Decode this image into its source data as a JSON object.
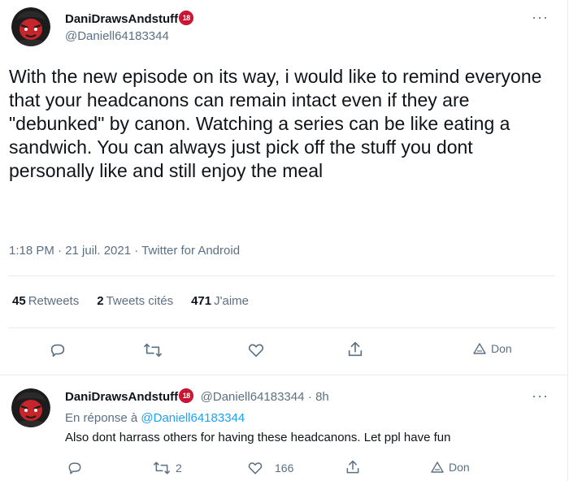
{
  "tweet": {
    "author": {
      "name": "DaniDrawsAndstuff",
      "badge": "18",
      "handle": "@Daniell64183344"
    },
    "more": "···",
    "text": "With the new episode on its way, i would like to remind everyone that your headcanons can remain intact even if they are \"debunked\" by canon. Watching a series can be like eating a sandwich. You can always just pick off the stuff you dont personally like and still enjoy the meal",
    "meta": "1:18 PM · 21 juil. 2021 · Twitter for Android",
    "stats": {
      "retweets_count": "45",
      "retweets_label": "Retweets",
      "quotes_count": "2",
      "quotes_label": "Tweets cités",
      "likes_count": "471",
      "likes_label": "J'aime"
    },
    "actions": {
      "donate_label": "Don"
    }
  },
  "reply": {
    "author": {
      "name": "DaniDrawsAndstuff",
      "badge": "18",
      "handle": "@Daniell64183344",
      "time": "· 8h"
    },
    "more": "···",
    "reply_to_prefix": "En réponse à",
    "reply_to_handle": "@Daniell64183344",
    "text": "Also dont harrass others for having these headcanons. Let ppl have fun",
    "actions": {
      "retweets": "2",
      "likes": "166",
      "donate_label": "Don"
    }
  },
  "colors": {
    "accent": "#1da1f2",
    "secondary_text": "#5b7083",
    "badge_red": "#c8102e",
    "avatar_bg": "#1c1c1c",
    "avatar_face": "#c8252b"
  },
  "icons": [
    "reply-icon",
    "retweet-icon",
    "like-icon",
    "share-icon",
    "donate-icon",
    "more-icon",
    "age-badge-icon"
  ]
}
